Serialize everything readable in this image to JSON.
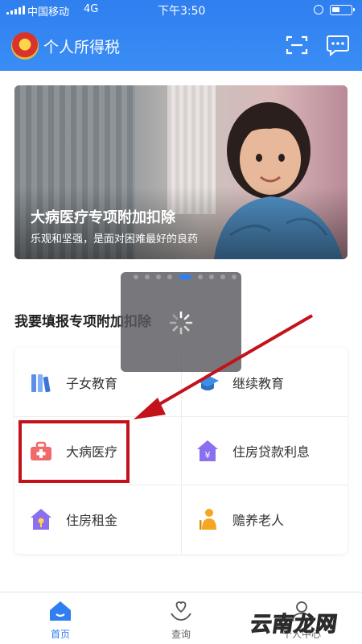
{
  "status_bar": {
    "carrier": "中国移动",
    "network": "4G",
    "time": "下午3:50"
  },
  "header": {
    "title": "个人所得税",
    "icons": [
      "tax-emblem-icon",
      "scan-icon",
      "message-icon"
    ]
  },
  "banner": {
    "title": "大病医疗专项附加扣除",
    "subtitle": "乐观和坚强，是面对困难最好的良药"
  },
  "carousel": {
    "count": 9,
    "active_index": 4
  },
  "section": {
    "title": "我要填报专项附加扣除"
  },
  "items": [
    {
      "label": "子女教育",
      "icon": "books-icon",
      "color": "#4a8df0"
    },
    {
      "label": "继续教育",
      "icon": "graduation-cap-icon",
      "color": "#3b8fe6"
    },
    {
      "label": "大病医疗",
      "icon": "medical-kit-icon",
      "color": "#f06a6a"
    },
    {
      "label": "住房贷款利息",
      "icon": "house-yen-icon",
      "color": "#8b6ff0"
    },
    {
      "label": "住房租金",
      "icon": "house-key-icon",
      "color": "#8b6ff0"
    },
    {
      "label": "赡养老人",
      "icon": "elderly-person-icon",
      "color": "#f5a623"
    }
  ],
  "tabs": [
    {
      "label": "首页",
      "icon": "home-icon",
      "active": true
    },
    {
      "label": "查询",
      "icon": "heart-hand-icon",
      "active": false
    },
    {
      "label": "个人中心",
      "icon": "user-icon",
      "active": false
    }
  ],
  "watermark": "云南龙网",
  "colors": {
    "brand_blue": "#2f7ff0",
    "highlight_red": "#c4121b"
  }
}
